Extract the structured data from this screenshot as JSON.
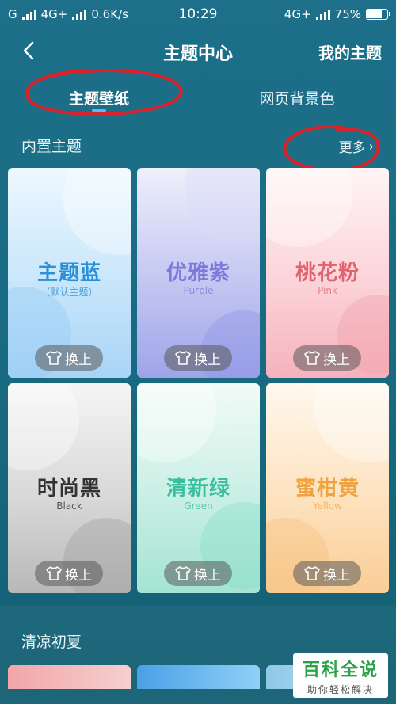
{
  "status_bar": {
    "carrier": "G",
    "network": "4G+",
    "speed": "0.6K/s",
    "time": "10:29",
    "network_right": "4G",
    "network_right_plus": "+",
    "battery": "75%",
    "battery_level": 0.75
  },
  "nav": {
    "title": "主题中心",
    "right_label": "我的主题"
  },
  "tabs": [
    {
      "label": "主题壁纸",
      "active": true
    },
    {
      "label": "网页背景色",
      "active": false
    }
  ],
  "builtin_section": {
    "title": "内置主题",
    "more": "更多"
  },
  "themes": [
    {
      "name": "主题蓝",
      "sub": "（默认主题）",
      "name_color": "#2a8fd6",
      "sub_color": "#4aa0dd",
      "apply": "换上"
    },
    {
      "name": "优雅紫",
      "sub": "Purple",
      "name_color": "#7f79dc",
      "sub_color": "#8f8ae0",
      "apply": "换上"
    },
    {
      "name": "桃花粉",
      "sub": "Pink",
      "name_color": "#e0636f",
      "sub_color": "#e2808a",
      "apply": "换上"
    },
    {
      "name": "时尚黑",
      "sub": "Black",
      "name_color": "#333333",
      "sub_color": "#555555",
      "apply": "换上"
    },
    {
      "name": "清新绿",
      "sub": "Green",
      "name_color": "#3bbfa0",
      "sub_color": "#56c8ab",
      "apply": "换上"
    },
    {
      "name": "蜜柑黄",
      "sub": "Yellow",
      "name_color": "#f0a23e",
      "sub_color": "#f2b562",
      "apply": "换上"
    }
  ],
  "summer_section": {
    "title": "清凉初夏"
  },
  "watermark": {
    "main": "百科全说",
    "sub": "助你轻松解决"
  },
  "colors": {
    "background": "#1b6e86",
    "tab_indicator": "#5ab6ff",
    "annotation_red": "#d8232a"
  }
}
